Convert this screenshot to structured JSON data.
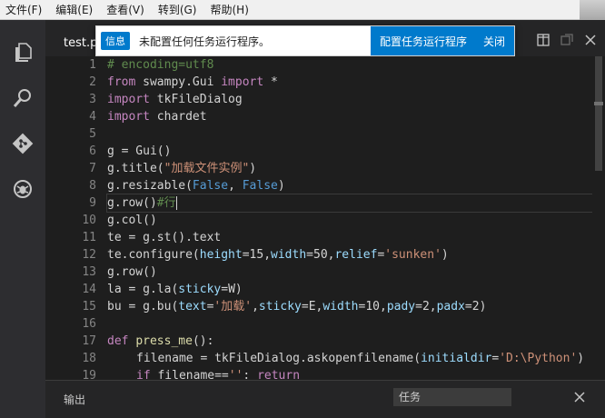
{
  "menu": [
    "文件(F)",
    "编辑(E)",
    "查看(V)",
    "转到(G)",
    "帮助(H)"
  ],
  "tab": {
    "label": "test.p"
  },
  "notification": {
    "badge": "信息",
    "message": "未配置任何任务运行程序。",
    "action_configure": "配置任务运行程序",
    "action_close": "关闭"
  },
  "activity_icons": [
    "explorer-icon",
    "search-icon",
    "git-icon",
    "debug-icon"
  ],
  "editor": {
    "lines": [
      {
        "n": "1",
        "tokens": [
          [
            "cmt",
            "# encoding=utf8"
          ]
        ]
      },
      {
        "n": "2",
        "tokens": [
          [
            "kw",
            "from"
          ],
          [
            "plain",
            " swampy.Gui "
          ],
          [
            "kw",
            "import"
          ],
          [
            "plain",
            " *"
          ]
        ]
      },
      {
        "n": "3",
        "tokens": [
          [
            "kw",
            "import"
          ],
          [
            "plain",
            " tkFileDialog"
          ]
        ]
      },
      {
        "n": "4",
        "tokens": [
          [
            "kw",
            "import"
          ],
          [
            "plain",
            " chardet"
          ]
        ]
      },
      {
        "n": "5",
        "tokens": []
      },
      {
        "n": "6",
        "tokens": [
          [
            "plain",
            "g = Gui()"
          ]
        ]
      },
      {
        "n": "7",
        "tokens": [
          [
            "plain",
            "g.title("
          ],
          [
            "str",
            "\"加载文件实例\""
          ],
          [
            "plain",
            ")"
          ]
        ]
      },
      {
        "n": "8",
        "tokens": [
          [
            "plain",
            "g.resizable("
          ],
          [
            "const",
            "False"
          ],
          [
            "plain",
            ", "
          ],
          [
            "const",
            "False"
          ],
          [
            "plain",
            ")"
          ]
        ]
      },
      {
        "n": "9",
        "current": true,
        "tokens": [
          [
            "plain",
            "g.row()"
          ],
          [
            "cmt",
            "#行"
          ]
        ]
      },
      {
        "n": "10",
        "tokens": [
          [
            "plain",
            "g.col()"
          ]
        ]
      },
      {
        "n": "11",
        "tokens": [
          [
            "plain",
            "te = g.st().text"
          ]
        ]
      },
      {
        "n": "12",
        "tokens": [
          [
            "plain",
            "te.configure("
          ],
          [
            "kwarg",
            "height"
          ],
          [
            "plain",
            "=15,"
          ],
          [
            "kwarg",
            "width"
          ],
          [
            "plain",
            "=50,"
          ],
          [
            "kwarg",
            "relief"
          ],
          [
            "plain",
            "="
          ],
          [
            "str",
            "'sunken'"
          ],
          [
            "plain",
            ")"
          ]
        ]
      },
      {
        "n": "13",
        "tokens": [
          [
            "plain",
            "g.row()"
          ]
        ]
      },
      {
        "n": "14",
        "tokens": [
          [
            "plain",
            "la = g.la("
          ],
          [
            "kwarg",
            "sticky"
          ],
          [
            "plain",
            "=W)"
          ]
        ]
      },
      {
        "n": "15",
        "tokens": [
          [
            "plain",
            "bu = g.bu("
          ],
          [
            "kwarg",
            "text"
          ],
          [
            "plain",
            "="
          ],
          [
            "str",
            "'加载'"
          ],
          [
            "plain",
            ","
          ],
          [
            "kwarg",
            "sticky"
          ],
          [
            "plain",
            "=E,"
          ],
          [
            "kwarg",
            "width"
          ],
          [
            "plain",
            "=10,"
          ],
          [
            "kwarg",
            "pady"
          ],
          [
            "plain",
            "=2,"
          ],
          [
            "kwarg",
            "padx"
          ],
          [
            "plain",
            "=2)"
          ]
        ]
      },
      {
        "n": "16",
        "tokens": []
      },
      {
        "n": "17",
        "tokens": [
          [
            "kw",
            "def"
          ],
          [
            "plain",
            " "
          ],
          [
            "fn",
            "press_me"
          ],
          [
            "plain",
            "():"
          ]
        ]
      },
      {
        "n": "18",
        "indent": 1,
        "tokens": [
          [
            "plain",
            "filename = tkFileDialog.askopenfilename("
          ],
          [
            "kwarg",
            "initialdir"
          ],
          [
            "plain",
            "="
          ],
          [
            "str",
            "'D:\\Python'"
          ],
          [
            "plain",
            ")"
          ]
        ]
      },
      {
        "n": "19",
        "indent": 1,
        "tokens": [
          [
            "kw",
            "if"
          ],
          [
            "plain",
            " filename=="
          ],
          [
            "str",
            "''"
          ],
          [
            "plain",
            ": "
          ],
          [
            "kw",
            "return"
          ]
        ]
      }
    ]
  },
  "panel": {
    "title": "输出",
    "select_value": "任务"
  },
  "colors": {
    "accent": "#007acc",
    "editor_bg": "#1e1e1e",
    "activity_bg": "#2d2d30"
  }
}
